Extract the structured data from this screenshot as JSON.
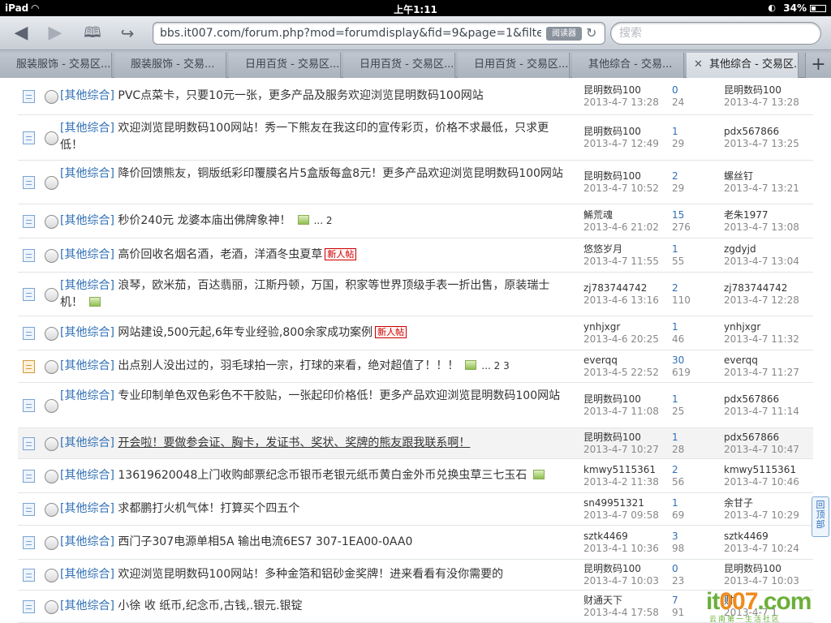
{
  "status_bar": {
    "device": "iPad",
    "time": "上午1:11",
    "battery": "34%",
    "battery_level": 0.34
  },
  "browser": {
    "url": "bbs.it007.com/forum.php?mod=forumdisplay&fid=9&page=1&filter=typ",
    "reader_label": "阅读器",
    "search_placeholder": "搜索",
    "tabs": [
      {
        "label": "服装服饰 - 交易区..."
      },
      {
        "label": "服装服饰 - 交易..."
      },
      {
        "label": "日用百货 - 交易区..."
      },
      {
        "label": "日用百货 - 交易区..."
      },
      {
        "label": "日用百货 - 交易区..."
      },
      {
        "label": "其他综合 - 交易..."
      },
      {
        "label": "其他综合 - 交易区..."
      }
    ],
    "active_tab": 6,
    "add_tab": "+"
  },
  "threads": [
    {
      "type": "[其他综合]",
      "title": "PVC点菜卡，只要10元一张，更多产品及服务欢迎浏览昆明数码100网站",
      "author": "昆明数码100",
      "post_date": "2013-4-7 13:28",
      "replies": "0",
      "views": "24",
      "last_user": "昆明数码100",
      "last_date": "2013-4-7 13:28"
    },
    {
      "type": "[其他综合]",
      "title": "欢迎浏览昆明数码100网站！秀一下熊友在我这印的宣传彩页，价格不求最低，只求更低！",
      "author": "昆明数码100",
      "post_date": "2013-4-7 12:49",
      "replies": "1",
      "views": "29",
      "last_user": "pdx567866",
      "last_date": "2013-4-7 13:25"
    },
    {
      "type": "[其他综合]",
      "title": "降价回馈熊友，铜版纸彩印覆膜名片5盒版每盒8元！更多产品欢迎浏览昆明数码100网站",
      "author": "昆明数码100",
      "post_date": "2013-4-7 10:52",
      "replies": "2",
      "views": "29",
      "last_user": "螺丝钉",
      "last_date": "2013-4-7 13:21"
    },
    {
      "type": "[其他综合]",
      "title": "秒价240元 龙婆本庙出佛牌象神！",
      "has_image": true,
      "pages": "... 2",
      "author": "鯑荒魂",
      "post_date": "2013-4-6 21:02",
      "replies": "15",
      "views": "276",
      "last_user": "老朱1977",
      "last_date": "2013-4-7 13:08"
    },
    {
      "type": "[其他综合]",
      "title": "高价回收名烟名酒，老酒，洋酒冬虫夏草",
      "badge": "新人帖",
      "author": "悠悠岁月",
      "post_date": "2013-4-7 11:55",
      "replies": "1",
      "views": "55",
      "last_user": "zgdyjd",
      "last_date": "2013-4-7 13:04"
    },
    {
      "type": "[其他综合]",
      "title": "浪琴，欧米茄，百达翡丽，江斯丹顿，万国，积家等世界顶级手表一折出售，原装瑞士机！",
      "has_image": true,
      "author": "zj783744742",
      "post_date": "2013-4-6 13:16",
      "replies": "2",
      "views": "110",
      "last_user": "zj783744742",
      "last_date": "2013-4-7 12:28"
    },
    {
      "type": "[其他综合]",
      "title": "网站建设,500元起,6年专业经验,800余家成功案例",
      "badge": "新人帖",
      "author": "ynhjxgr",
      "post_date": "2013-4-6 20:25",
      "replies": "1",
      "views": "46",
      "last_user": "ynhjxgr",
      "last_date": "2013-4-7 11:32"
    },
    {
      "type": "[其他综合]",
      "title": "出点别人没出过的，羽毛球拍一宗，打球的来看，绝对超值了！！！",
      "has_image": true,
      "pages": "... 2  3",
      "hot": true,
      "author": "everqq",
      "post_date": "2013-4-5 22:52",
      "replies": "30",
      "views": "619",
      "last_user": "everqq",
      "last_date": "2013-4-7 11:27"
    },
    {
      "type": "[其他综合]",
      "title": "专业印制单色双色彩色不干胶贴，一张起印价格低！更多产品欢迎浏览昆明数码100网站",
      "author": "昆明数码100",
      "post_date": "2013-4-7 11:08",
      "replies": "1",
      "views": "25",
      "last_user": "pdx567866",
      "last_date": "2013-4-7 11:14"
    },
    {
      "type": "[其他综合]",
      "title": "开会啦！要做参会证、胸卡，发证书、奖状、奖牌的熊友跟我联系啊！",
      "underline": true,
      "hover": true,
      "author": "昆明数码100",
      "post_date": "2013-4-7 10:27",
      "replies": "1",
      "views": "28",
      "last_user": "pdx567866",
      "last_date": "2013-4-7 10:47"
    },
    {
      "type": "[其他综合]",
      "title": "13619620048上门收购邮票纪念币银币老银元纸币黄白金外币兑换虫草三七玉石",
      "has_image": true,
      "author": "kmwy5115361",
      "post_date": "2013-4-2 11:38",
      "replies": "2",
      "views": "56",
      "last_user": "kmwy5115361",
      "last_date": "2013-4-7 10:46"
    },
    {
      "type": "[其他综合]",
      "title": "求都鹏打火机气体！打算买个四五个",
      "author": "sn49951321",
      "post_date": "2013-4-7 09:58",
      "replies": "1",
      "views": "69",
      "last_user": "余甘子",
      "last_date": "2013-4-7 10:29"
    },
    {
      "type": "[其他综合]",
      "title": "西门子307电源单相5A 输出电流6ES7 307-1EA00-0AA0",
      "author": "sztk4469",
      "post_date": "2013-4-1 10:36",
      "replies": "3",
      "views": "98",
      "last_user": "sztk4469",
      "last_date": "2013-4-7 10:24"
    },
    {
      "type": "[其他综合]",
      "title": "欢迎浏览昆明数码100网站！多种金箔和铝砂金奖牌！进来看看有没你需要的",
      "author": "昆明数码100",
      "post_date": "2013-4-7 10:03",
      "replies": "0",
      "views": "23",
      "last_user": "昆明数码100",
      "last_date": "2013-4-7 10:03"
    },
    {
      "type": "[其他综合]",
      "title": "小徐 收 纸币,纪念币,古钱,.银元.银锭",
      "author": "财通天下",
      "post_date": "2013-4-4 17:58",
      "replies": "7",
      "views": "91",
      "last_user": "财",
      "last_date": "2013-4-7 1"
    }
  ],
  "back_to_top": "回顶部",
  "watermark": {
    "logo_a": "it",
    "logo_b": "007",
    "logo_c": ".com",
    "subtitle": "云南第一生活社区"
  }
}
